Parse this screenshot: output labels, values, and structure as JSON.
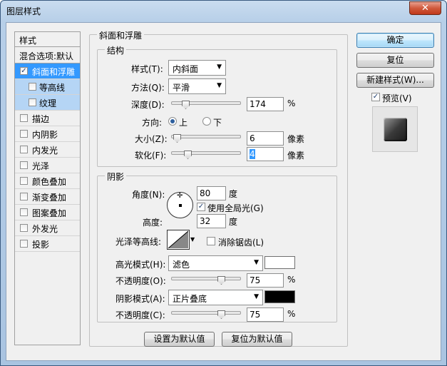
{
  "window": {
    "title": "图层样式",
    "close": "✕"
  },
  "styles_list": {
    "header": "样式",
    "blend_options": "混合选项:默认",
    "items": [
      {
        "label": "斜面和浮雕",
        "checked": true,
        "selected": true,
        "sub": false
      },
      {
        "label": "等高线",
        "checked": false,
        "selected": false,
        "sub": true
      },
      {
        "label": "纹理",
        "checked": false,
        "selected": false,
        "sub": true
      },
      {
        "label": "描边",
        "checked": false,
        "selected": false,
        "sub": false
      },
      {
        "label": "内阴影",
        "checked": false,
        "selected": false,
        "sub": false
      },
      {
        "label": "内发光",
        "checked": false,
        "selected": false,
        "sub": false
      },
      {
        "label": "光泽",
        "checked": false,
        "selected": false,
        "sub": false
      },
      {
        "label": "颜色叠加",
        "checked": false,
        "selected": false,
        "sub": false
      },
      {
        "label": "渐变叠加",
        "checked": false,
        "selected": false,
        "sub": false
      },
      {
        "label": "图案叠加",
        "checked": false,
        "selected": false,
        "sub": false
      },
      {
        "label": "外发光",
        "checked": false,
        "selected": false,
        "sub": false
      },
      {
        "label": "投影",
        "checked": false,
        "selected": false,
        "sub": false
      }
    ]
  },
  "bevel": {
    "title": "斜面和浮雕",
    "structure": {
      "title": "结构",
      "style_label": "样式(T):",
      "style_value": "内斜面",
      "technique_label": "方法(Q):",
      "technique_value": "平滑",
      "depth_label": "深度(D):",
      "depth_value": "174",
      "depth_unit": "%",
      "depth_level": 0.17,
      "direction_label": "方向:",
      "direction_up": "上",
      "direction_down": "下",
      "size_label": "大小(Z):",
      "size_value": "6",
      "size_unit": "像素",
      "size_level": 0.02,
      "soften_label": "软化(F):",
      "soften_value": "4",
      "soften_unit": "像素",
      "soften_level": 0.2
    },
    "shading": {
      "title": "阴影",
      "angle_label": "角度(N):",
      "angle_value": "80",
      "angle_unit": "度",
      "global_light_label": "使用全局光(G)",
      "altitude_label": "高度:",
      "altitude_value": "32",
      "altitude_unit": "度",
      "gloss_contour_label": "光泽等高线:",
      "anti_alias_label": "消除锯齿(L)",
      "highlight_mode_label": "高光模式(H):",
      "highlight_mode_value": "滤色",
      "highlight_color": "#ffffff",
      "highlight_opacity_label": "不透明度(O):",
      "highlight_opacity_value": "75",
      "highlight_opacity_level": 0.75,
      "shadow_mode_label": "阴影模式(A):",
      "shadow_mode_value": "正片叠底",
      "shadow_color": "#000000",
      "shadow_opacity_label": "不透明度(C):",
      "shadow_opacity_value": "75",
      "shadow_opacity_level": 0.75,
      "percent": "%"
    },
    "make_default": "设置为默认值",
    "reset_default": "复位为默认值"
  },
  "buttons": {
    "ok": "确定",
    "reset": "复位",
    "new_style": "新建样式(W)...",
    "preview": "预览(V)"
  }
}
